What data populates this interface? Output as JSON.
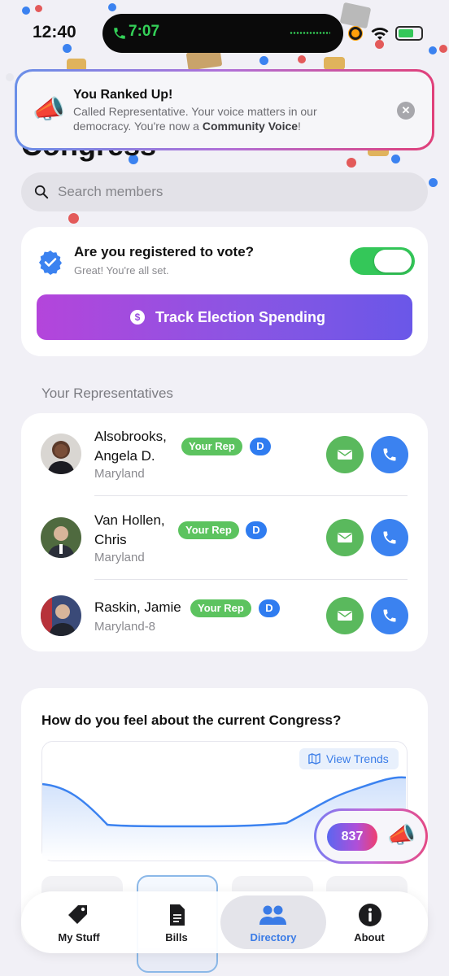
{
  "status_bar": {
    "time": "12:40",
    "call_time": "7:07"
  },
  "page": {
    "title": "Congress"
  },
  "toast": {
    "icon": "megaphone-icon",
    "title": "You Ranked Up!",
    "message_prefix": "Called Representative. Your voice matters in our democracy. You're now a ",
    "message_bold": "Community Voice",
    "message_suffix": "!"
  },
  "search": {
    "placeholder": "Search members"
  },
  "vote": {
    "question": "Are you registered to vote?",
    "status": "Great! You're all set.",
    "toggle_on": true,
    "track_button": "Track Election Spending"
  },
  "representatives": {
    "section_label": "Your Representatives",
    "items": [
      {
        "name_line1": "Alsobrooks,",
        "name_line2": "Angela D.",
        "state": "Maryland",
        "badge": "Your Rep",
        "party": "D"
      },
      {
        "name_line1": "Van Hollen,",
        "name_line2": "Chris",
        "state": "Maryland",
        "badge": "Your Rep",
        "party": "D"
      },
      {
        "name_line1": "Raskin, Jamie",
        "name_line2": "",
        "state": "Maryland-8",
        "badge": "Your Rep",
        "party": "D"
      }
    ]
  },
  "sentiment": {
    "question": "How do you feel about the current Congress?",
    "view_trends": "View Trends"
  },
  "points": {
    "count": "837"
  },
  "tabs": [
    {
      "label": "My Stuff",
      "icon": "tag-icon"
    },
    {
      "label": "Bills",
      "icon": "document-icon"
    },
    {
      "label": "Directory",
      "icon": "people-icon",
      "active": true
    },
    {
      "label": "About",
      "icon": "info-icon"
    }
  ],
  "colors": {
    "accent_green": "#34c759",
    "accent_blue": "#3b82f0",
    "gradient_start": "#b445db",
    "gradient_end": "#6a57e8"
  }
}
